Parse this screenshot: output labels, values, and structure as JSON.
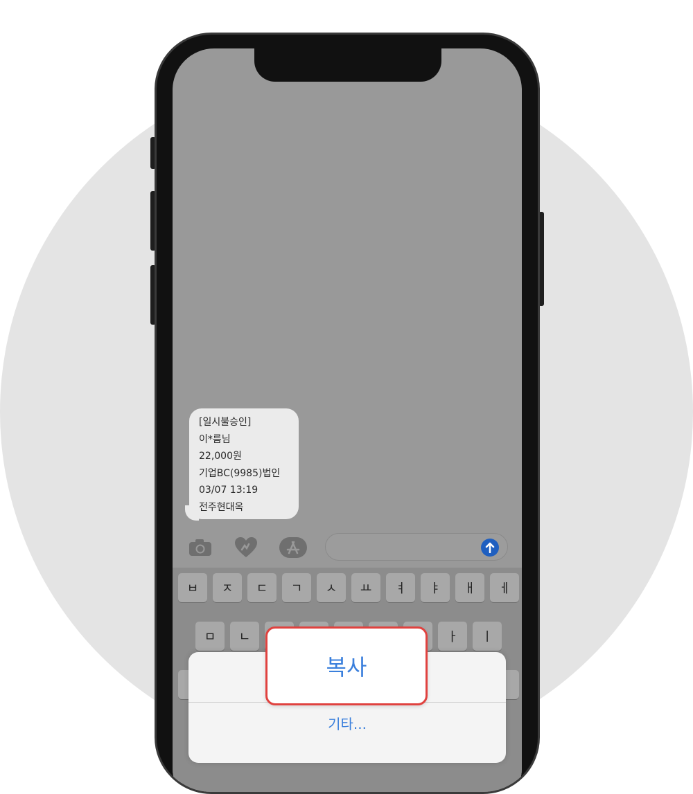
{
  "message": {
    "lines": [
      "[일시불승인]",
      "이*름님",
      "22,000원",
      "기업BC(9985)법인",
      "03/07 13:19",
      "전주현대옥"
    ]
  },
  "toolbar": {
    "icons": [
      "camera-icon",
      "digital-touch-icon",
      "app-store-icon"
    ],
    "send_icon": "arrow-up-icon"
  },
  "keyboard": {
    "row1": [
      "ㅂ",
      "ㅈ",
      "ㄷ",
      "ㄱ",
      "ㅅ",
      "ㅛ",
      "ㅕ",
      "ㅑ",
      "ㅐ",
      "ㅔ"
    ],
    "row2_visible": [
      "ㅁ",
      "ㄴ",
      "ㅏ",
      "ㅣ"
    ]
  },
  "context_menu": {
    "copy_label": "복사",
    "other_label": "기타..."
  },
  "colors": {
    "background_circle": "#e4e4e4",
    "screen": "#999999",
    "accent_blue": "#3a7fdc",
    "highlight_border": "#e0423f",
    "send_button": "#1f5fc0"
  }
}
